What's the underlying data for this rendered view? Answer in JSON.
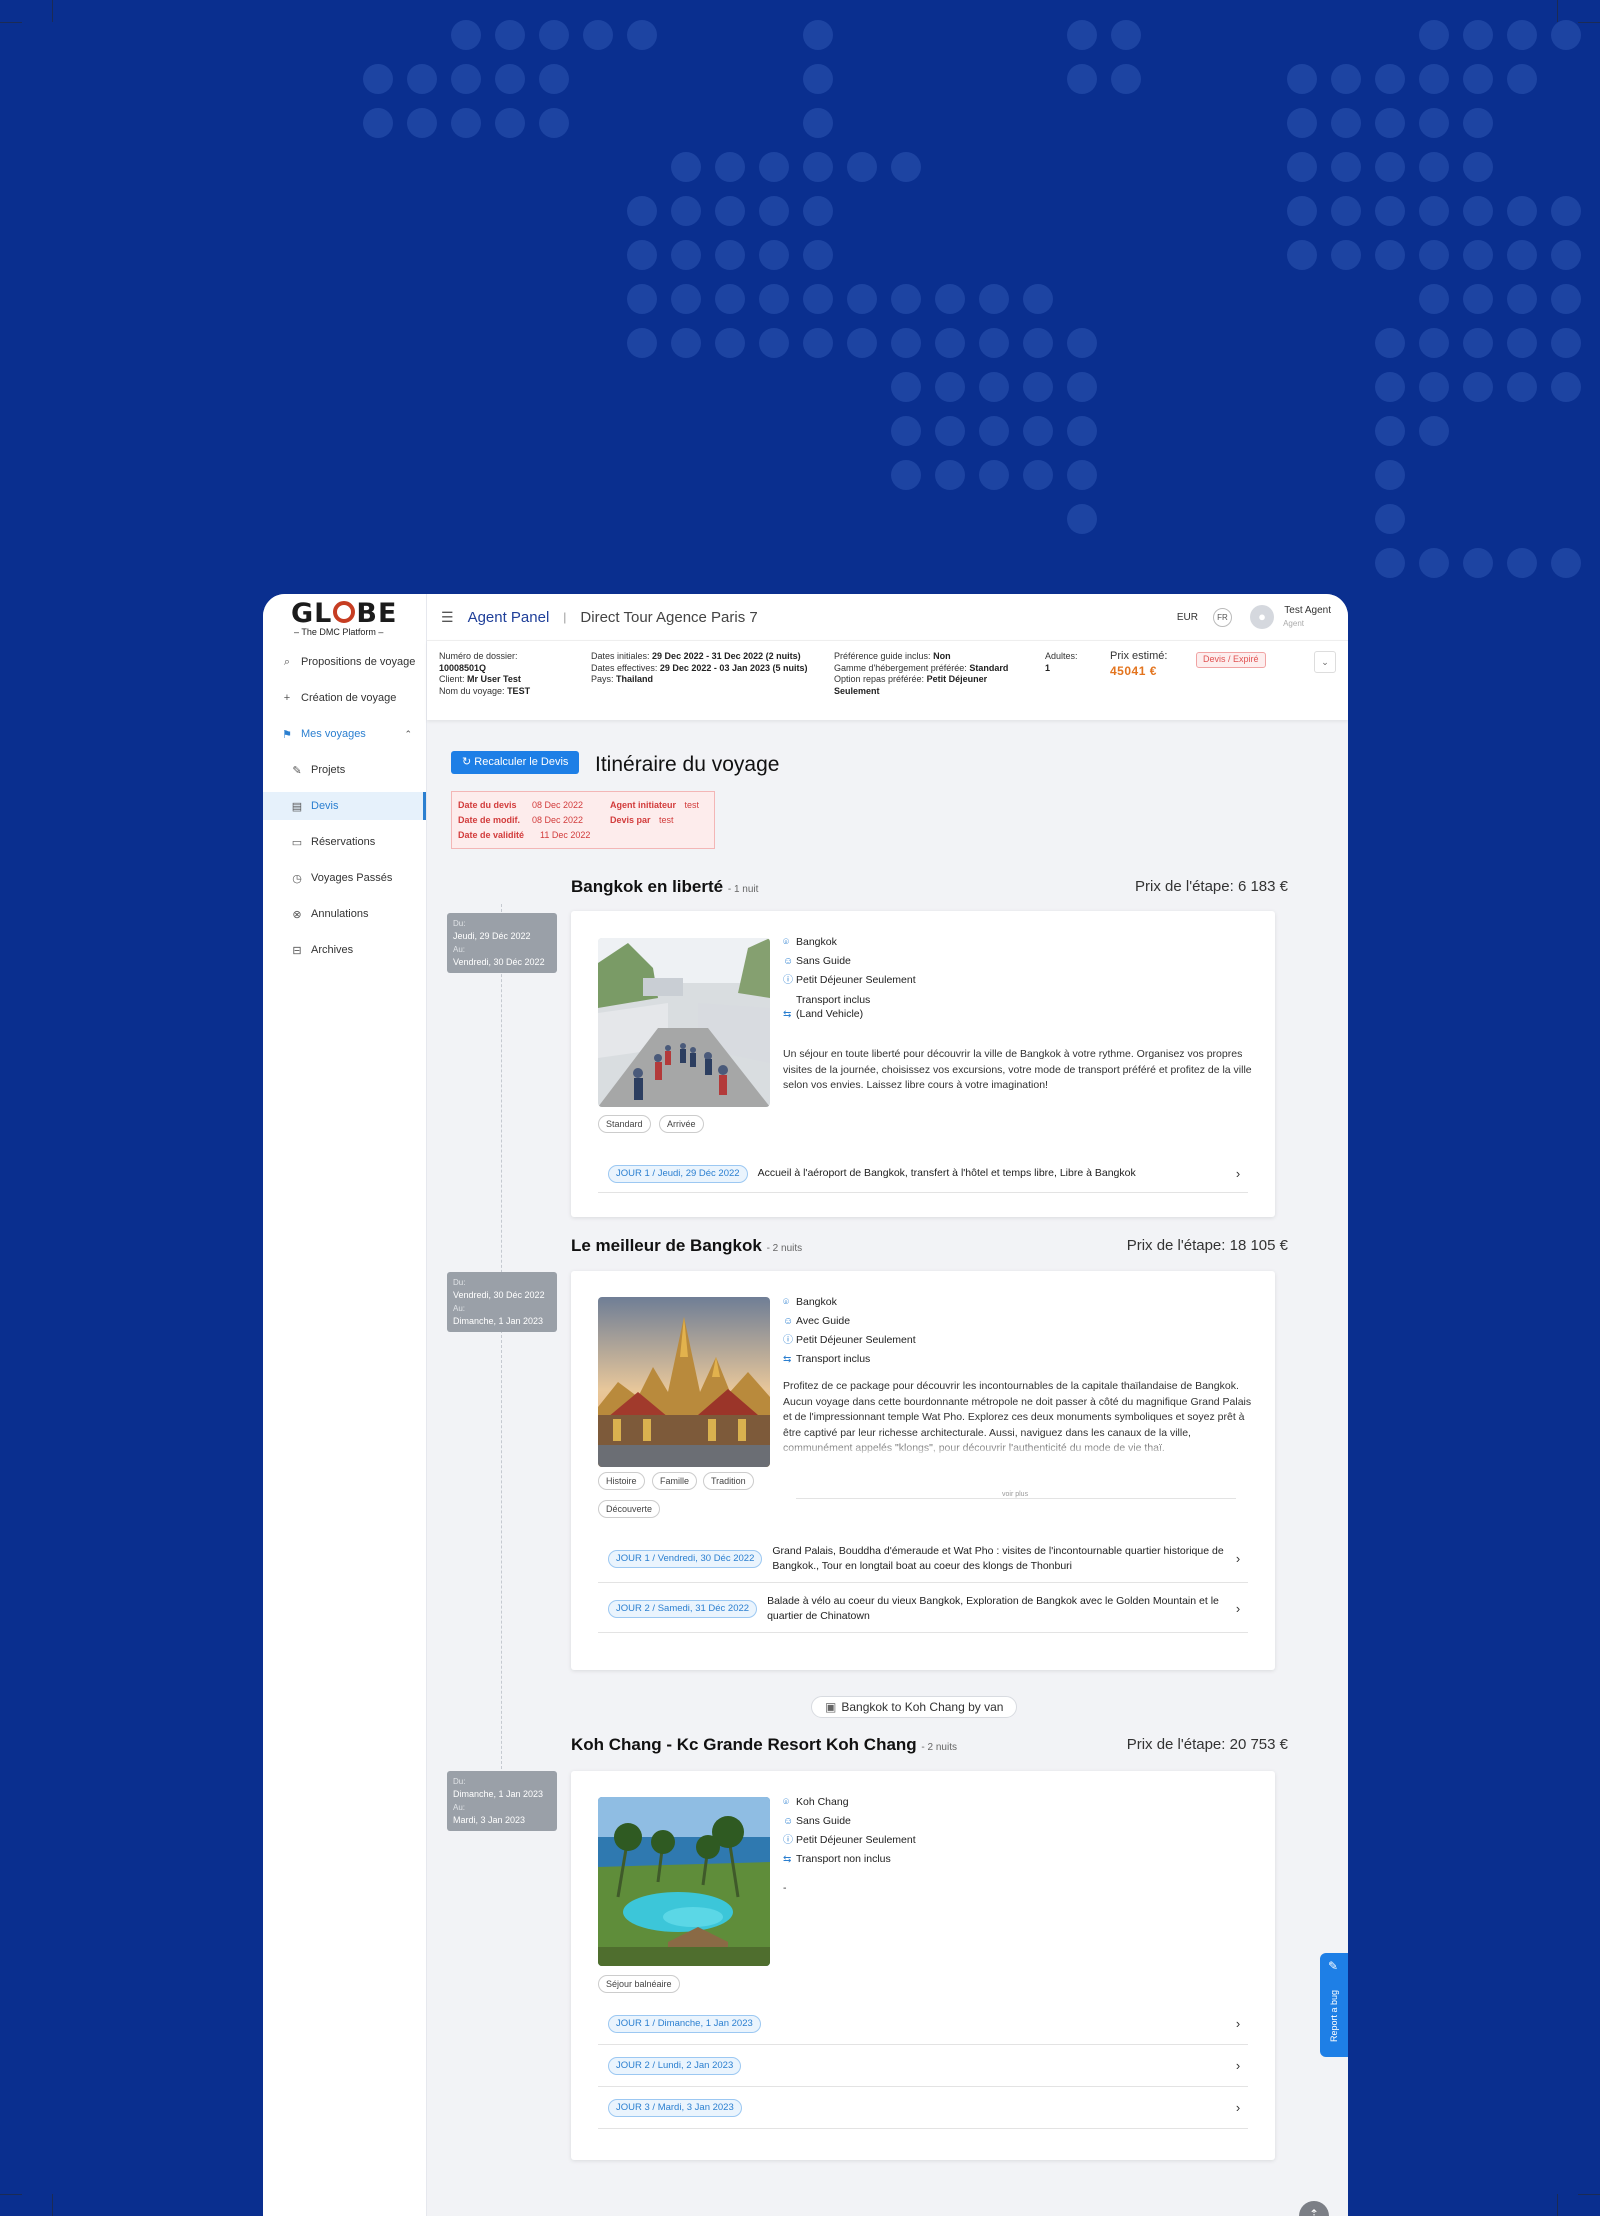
{
  "app": {
    "logo_text": "GLOBE",
    "logo_sub": "– The DMC Platform –"
  },
  "sidebar": {
    "items": [
      {
        "label": "Propositions de voyage",
        "icon": "search-icon"
      },
      {
        "label": "Création de voyage",
        "icon": "plus-icon"
      },
      {
        "label": "Mes voyages",
        "icon": "flag-icon"
      },
      {
        "label": "Projets",
        "icon": "pencil-icon"
      },
      {
        "label": "Devis",
        "icon": "document-icon"
      },
      {
        "label": "Réservations",
        "icon": "ticket-icon"
      },
      {
        "label": "Voyages Passés",
        "icon": "history-icon"
      },
      {
        "label": "Annulations",
        "icon": "cancel-icon"
      },
      {
        "label": "Archives",
        "icon": "archive-icon"
      }
    ]
  },
  "topbar": {
    "panel": "Agent Panel",
    "separator": "|",
    "agency": "Direct Tour Agence Paris 7",
    "currency": "EUR",
    "lang": "FR",
    "user_name": "Test Agent",
    "user_role": "Agent"
  },
  "details": {
    "dossier_label": "Numéro de dossier:",
    "dossier_value": "10008501Q",
    "client_label": "Client:",
    "client_value": "Mr User Test",
    "voyage_label": "Nom du voyage:",
    "voyage_value": "TEST",
    "dates_init_label": "Dates initiales:",
    "dates_init_value": "29 Dec 2022 - 31 Dec 2022 (2 nuits)",
    "dates_eff_label": "Dates effectives:",
    "dates_eff_value": "29 Dec 2022 - 03 Jan 2023 (5 nuits)",
    "pays_label": "Pays:",
    "pays_value": "Thailand",
    "guide_label": "Préférence guide inclus:",
    "guide_value": "Non",
    "heb_label": "Gamme d'hébergement préférée:",
    "heb_value": "Standard",
    "repas_label": "Option repas préférée:",
    "repas_value": "Petit Déjeuner Seulement",
    "adultes_label": "Adultes:",
    "adultes_value": "1",
    "prix_label": "Prix estimé:",
    "prix_value": "45041 €",
    "status": "Devis / Expiré"
  },
  "main": {
    "recalc_button": "Recalculer le Devis",
    "title": "Itinéraire du voyage",
    "quote": {
      "date_devis_label": "Date du devis",
      "date_devis": "08 Dec 2022",
      "date_modif_label": "Date de modif.",
      "date_modif": "08 Dec 2022",
      "date_validite_label": "Date de validité",
      "date_validite": "11 Dec 2022",
      "agent_label": "Agent initiateur",
      "agent": "test",
      "devis_par_label": "Devis par",
      "devis_par": "test"
    }
  },
  "stages": [
    {
      "title": "Bangkok en liberté",
      "nights": "- 1 nuit",
      "price": "Prix de l'étape: 6 183 €",
      "du_label": "Du:",
      "du": "Jeudi, 29 Déc 2022",
      "au_label": "Au:",
      "au": "Vendredi, 30 Déc 2022",
      "location": "Bangkok",
      "guide": "Sans Guide",
      "meal": "Petit Déjeuner Seulement",
      "transport": "Transport inclus",
      "transport2": "(Land Vehicle)",
      "description": "Un séjour en toute liberté pour découvrir la ville de Bangkok à votre rythme. Organisez vos propres visites de la journée, choisissez vos excursions, votre mode de transport préféré et profitez de la ville selon vos envies. Laissez libre cours à votre imagination!",
      "tags": [
        "Standard",
        "Arrivée"
      ],
      "days": [
        {
          "pill": "JOUR 1 / Jeudi, 29 Déc 2022",
          "text": "Accueil à l'aéroport de Bangkok, transfert à l'hôtel et temps libre, Libre à Bangkok"
        }
      ]
    },
    {
      "title": "Le meilleur de Bangkok",
      "nights": "- 2 nuits",
      "price": "Prix de l'étape: 18 105 €",
      "du_label": "Du:",
      "du": "Vendredi, 30 Déc 2022",
      "au_label": "Au:",
      "au": "Dimanche, 1 Jan 2023",
      "location": "Bangkok",
      "guide": "Avec Guide",
      "meal": "Petit Déjeuner Seulement",
      "transport": "Transport inclus",
      "description": "Profitez de ce package pour découvrir les incontournables de la capitale thaïlandaise de Bangkok. Aucun voyage dans cette bourdonnante métropole ne doit passer à côté du magnifique Grand Palais et de l'impressionnant temple Wat Pho. Explorez ces deux monuments symboliques et soyez prêt à être captivé par leur richesse architecturale. Aussi, naviguez dans les canaux de la ville, communément appelés \"klongs\", pour découvrir l'authenticité du mode de vie thaï.",
      "voir_plus": "voir plus",
      "tags": [
        "Histoire",
        "Famille",
        "Tradition",
        "Découverte"
      ],
      "days": [
        {
          "pill": "JOUR 1 / Vendredi, 30 Déc 2022",
          "text": "Grand Palais, Bouddha d'émeraude et Wat Pho : visites de l'incontournable quartier historique de Bangkok., Tour en longtail boat au coeur des klongs de Thonburi"
        },
        {
          "pill": "JOUR 2 / Samedi, 31 Déc 2022",
          "text": "Balade à vélo au coeur du vieux Bangkok, Exploration de Bangkok avec le Golden Mountain et le quartier de Chinatown"
        }
      ]
    },
    {
      "title": "Koh Chang - Kc Grande Resort Koh Chang",
      "nights": "- 2 nuits",
      "price": "Prix de l'étape: 20 753 €",
      "du_label": "Du:",
      "du": "Dimanche, 1 Jan 2023",
      "au_label": "Au:",
      "au": "Mardi, 3 Jan 2023",
      "location": "Koh Chang",
      "guide": "Sans Guide",
      "meal": "Petit Déjeuner Seulement",
      "transport": "Transport non inclus",
      "description": "-",
      "tags": [
        "Séjour balnéaire"
      ],
      "days": [
        {
          "pill": "JOUR 1 / Dimanche, 1 Jan 2023",
          "text": ""
        },
        {
          "pill": "JOUR 2 / Lundi, 2 Jan 2023",
          "text": ""
        },
        {
          "pill": "JOUR 3 / Mardi, 3 Jan 2023",
          "text": ""
        }
      ]
    }
  ],
  "transfer": "Bangkok to Koh Chang by van",
  "report_bug": "Report a bug",
  "colors": {
    "background": "#0a2f8f",
    "accent": "#2b7fd0",
    "price": "#e3741e",
    "status": "#e05252"
  }
}
